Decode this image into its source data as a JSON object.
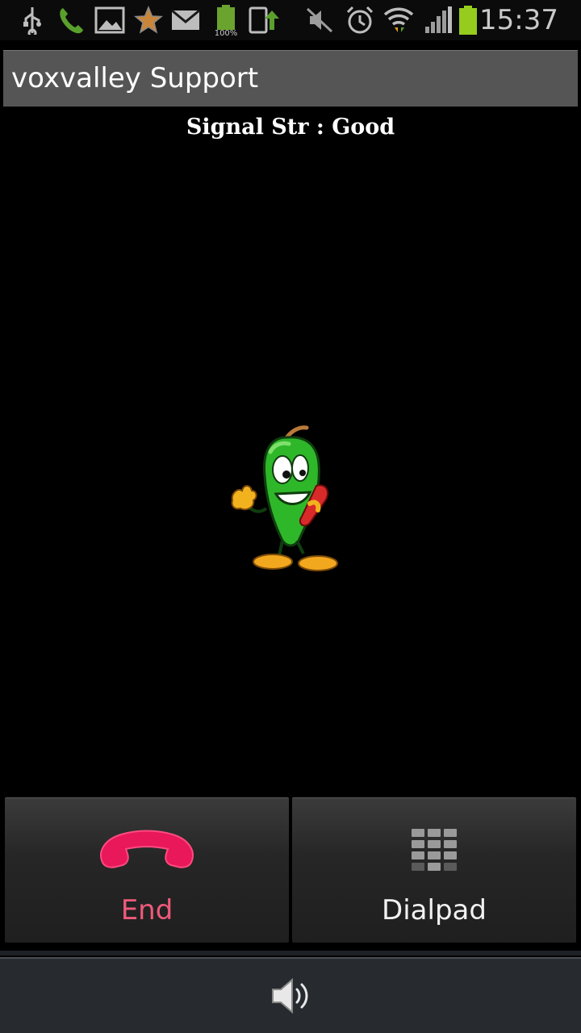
{
  "status_bar": {
    "time": "15:37",
    "battery_notification_percent": "100%",
    "icons": [
      "usb-icon",
      "phone-call-icon",
      "gallery-icon",
      "star-icon",
      "email-icon",
      "battery-100-icon",
      "sync-upload-icon",
      "mute-icon",
      "alarm-icon",
      "wifi-icon",
      "signal-icon",
      "battery-icon"
    ]
  },
  "header": {
    "title": "voxvalley Support"
  },
  "call": {
    "signal_text": "Signal Str : Good",
    "mascot": "pepper-mascot-icon"
  },
  "actions": {
    "end_label": "End",
    "dialpad_label": "Dialpad"
  },
  "bottom": {
    "speaker": "speaker-icon"
  },
  "colors": {
    "end_accent": "#ef5a7a",
    "green_icons": "#5aa02c",
    "title_bar": "#555555"
  }
}
